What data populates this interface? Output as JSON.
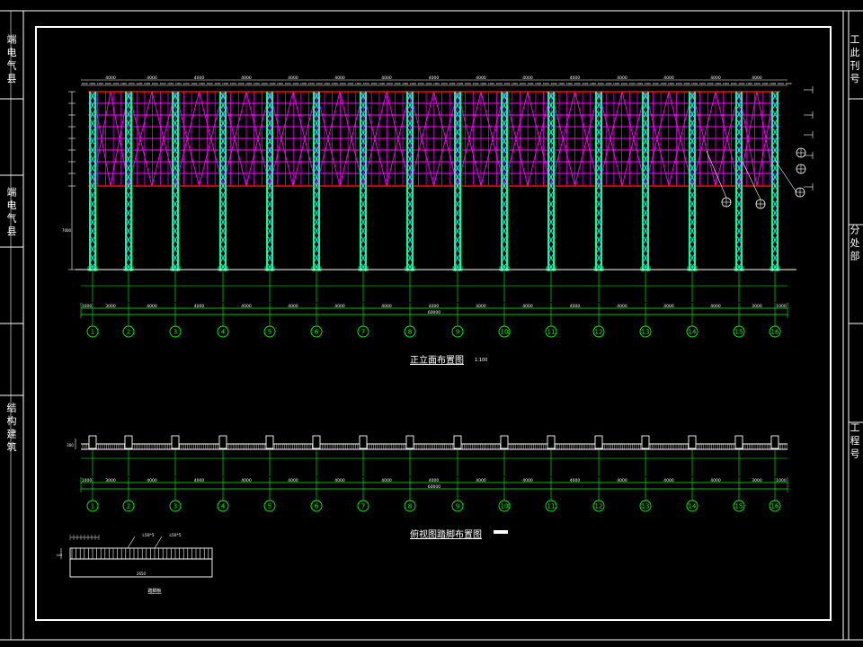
{
  "drawing": {
    "front_elevation_title": "正立面布置图",
    "front_elevation_scale": "1:100",
    "section_title": "俯视图踏脚布置图",
    "detail_title": "踏脚板",
    "detail_callouts": [
      "L50*5",
      "L50*5"
    ],
    "left_column_labels": [
      "端 电 气 县",
      "端 电 气 县",
      "结 构 建 筑"
    ],
    "right_column_labels": [
      "工 此 刊 号",
      "分 处 部",
      "工 程 号"
    ]
  },
  "grid": {
    "axis_numbers": [
      "1",
      "2",
      "3",
      "4",
      "5",
      "6",
      "7",
      "8",
      "9",
      "10",
      "11",
      "12",
      "13",
      "14",
      "15",
      "16"
    ],
    "bay_dims": [
      "1000",
      "3000",
      "4000",
      "4000",
      "4000",
      "4000",
      "4000",
      "4000",
      "4000",
      "4000",
      "4000",
      "4000",
      "4000",
      "4000",
      "4000",
      "3000",
      "1000"
    ],
    "total_dim": "60000",
    "top_dims": [
      "4000",
      "4000",
      "4000",
      "4000",
      "4000",
      "4000",
      "4000",
      "4000",
      "4000",
      "4000",
      "4000",
      "4000",
      "4000",
      "4000",
      "4000"
    ],
    "height_dim": "7000"
  },
  "colors": {
    "background": "#000000",
    "border": "#ffffff",
    "column": "#00ff80",
    "column_brace": "#00ffff",
    "truss": "#ff00ff",
    "chord": "#ff0000",
    "dimension": "#00ff00",
    "axis_bubble": "#00ff00",
    "text": "#ffffff"
  }
}
